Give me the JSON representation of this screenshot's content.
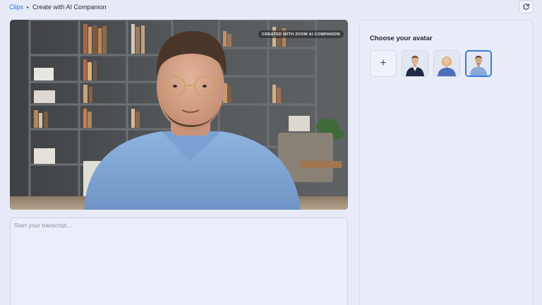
{
  "breadcrumb": {
    "root": "Clips",
    "separator": "▸",
    "current": "Create with AI Companion"
  },
  "toolbar": {
    "refresh_icon": "refresh-icon"
  },
  "video": {
    "watermark": "CREATED WITH ZOOM AI COMPANION"
  },
  "transcript": {
    "placeholder": "Start your transcript...",
    "value": ""
  },
  "avatar_panel": {
    "title": "Choose your avatar",
    "add_glyph": "+",
    "avatars": [
      {
        "name": "avatar-man-suit",
        "selected": false
      },
      {
        "name": "avatar-woman-blonde",
        "selected": false
      },
      {
        "name": "avatar-man-glasses",
        "selected": true
      }
    ]
  },
  "colors": {
    "accent": "#3b7ae0",
    "link": "#2f6bd8",
    "background": "#e6ebf7"
  }
}
